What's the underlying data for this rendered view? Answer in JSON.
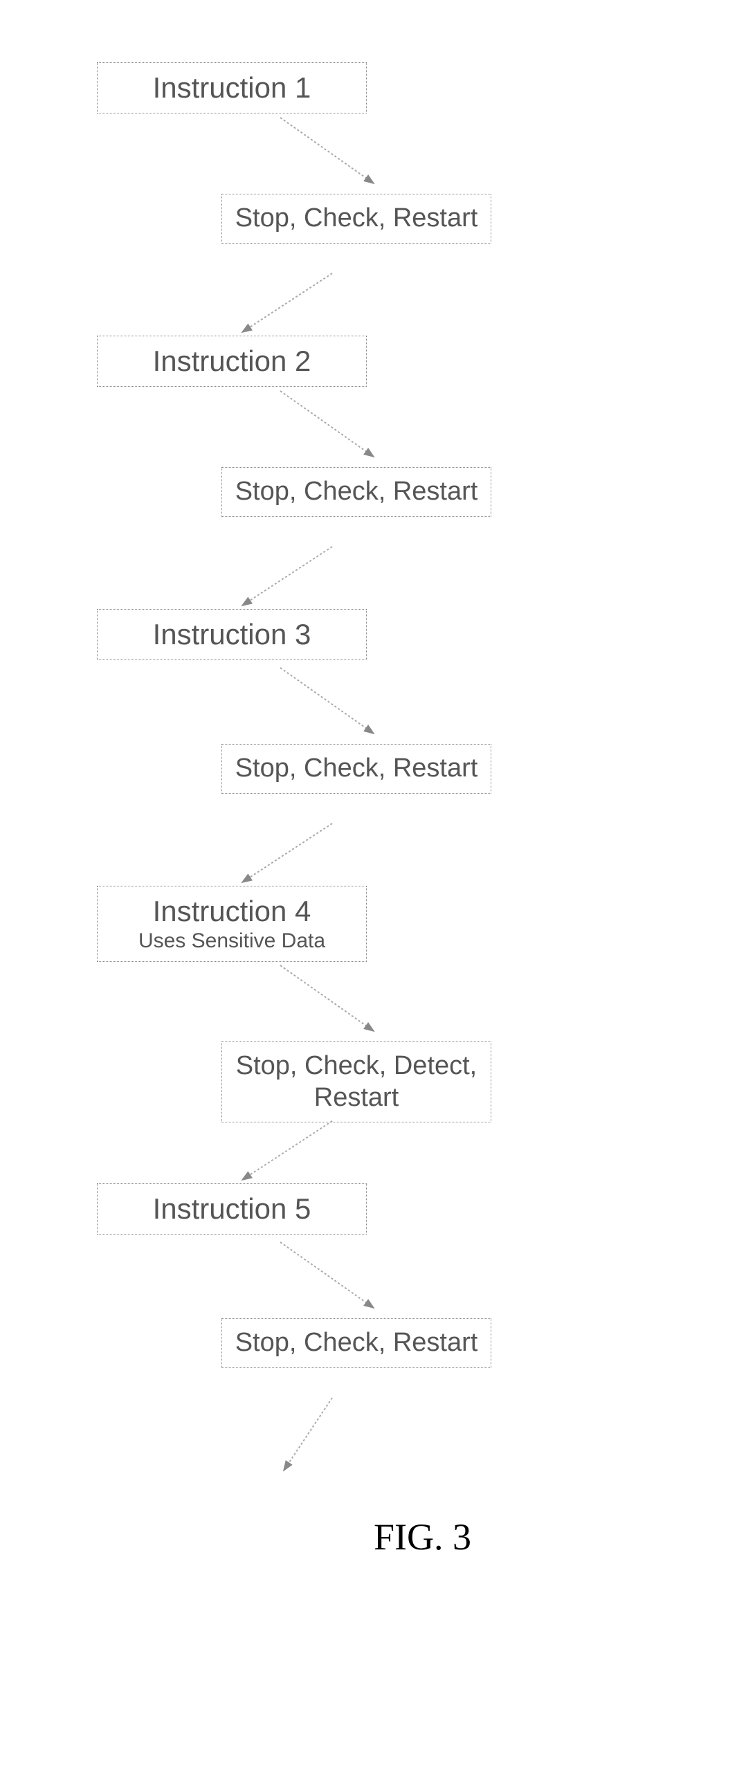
{
  "flow": {
    "step1": {
      "label": "Instruction 1"
    },
    "check1": {
      "label": "Stop, Check, Restart"
    },
    "step2": {
      "label": "Instruction 2"
    },
    "check2": {
      "label": "Stop, Check, Restart"
    },
    "step3": {
      "label": "Instruction 3"
    },
    "check3": {
      "label": "Stop, Check, Restart"
    },
    "step4": {
      "label": "Instruction 4",
      "sub": "Uses Sensitive Data"
    },
    "check4": {
      "label": "Stop, Check, Detect, Restart"
    },
    "step5": {
      "label": "Instruction 5"
    },
    "check5": {
      "label": "Stop, Check, Restart"
    }
  },
  "figure_label": "FIG. 3"
}
